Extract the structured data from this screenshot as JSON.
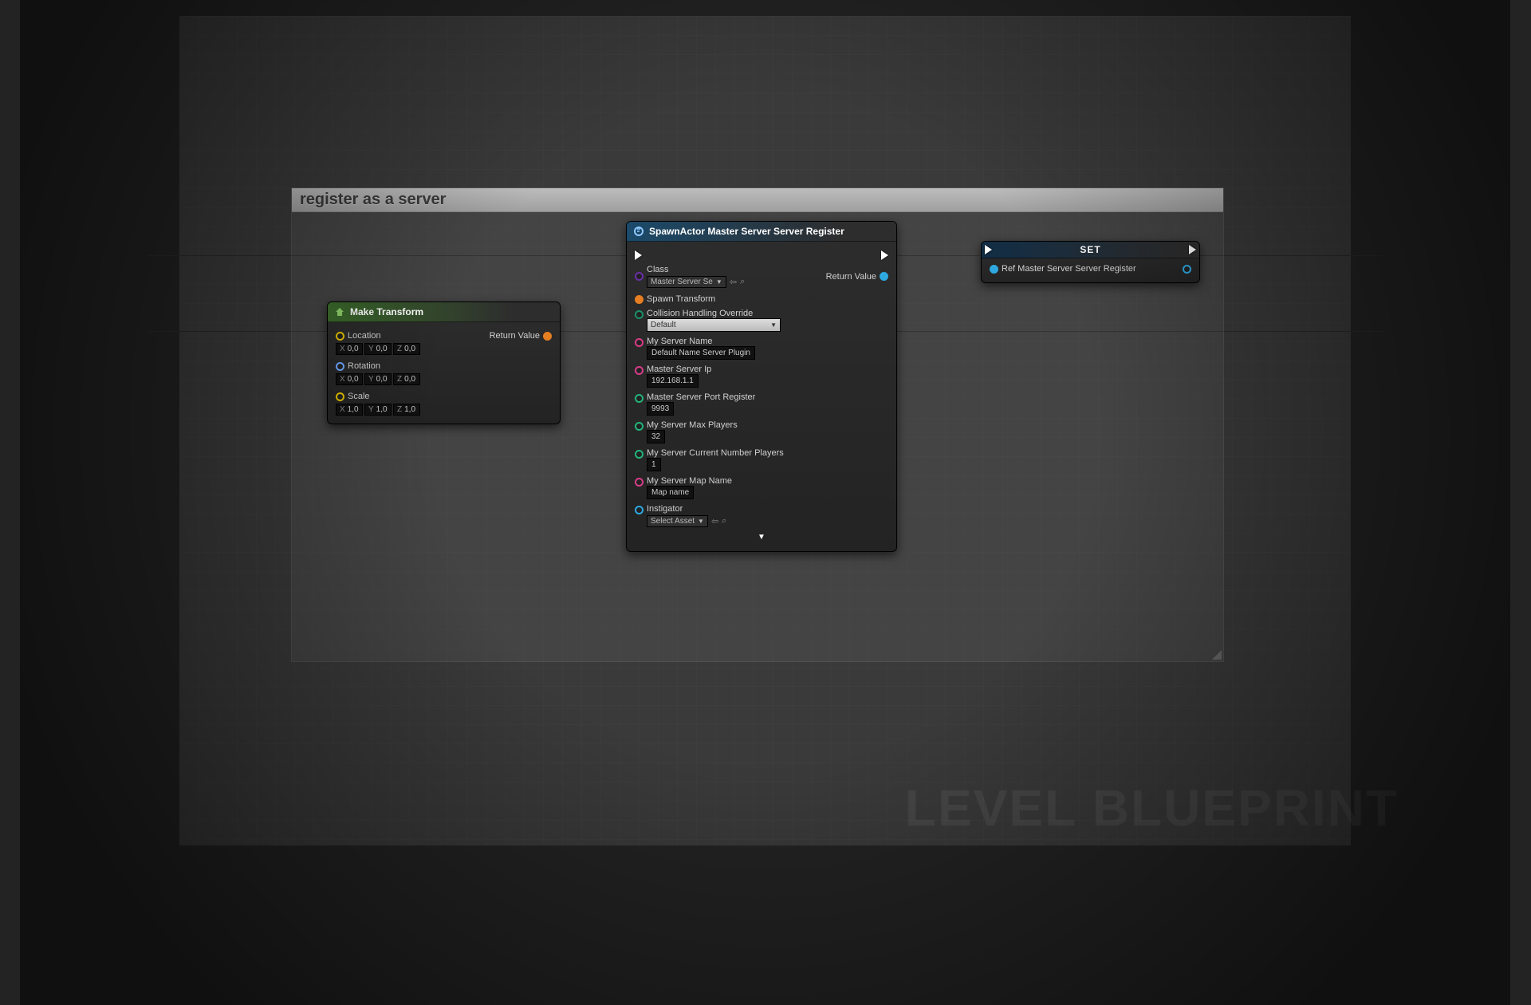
{
  "watermark": "LEVEL BLUEPRINT",
  "comment": {
    "title": "register as a server"
  },
  "makeTransform": {
    "title": "Make Transform",
    "loc_label": "Location",
    "rot_label": "Rotation",
    "scale_label": "Scale",
    "return_label": "Return Value",
    "loc": {
      "x": "0,0",
      "y": "0,0",
      "z": "0,0"
    },
    "rot": {
      "x": "0,0",
      "y": "0,0",
      "z": "0,0"
    },
    "scale": {
      "x": "1,0",
      "y": "1,0",
      "z": "1,0"
    },
    "ax_x": "X",
    "ax_y": "Y",
    "ax_z": "Z"
  },
  "spawn": {
    "title": "SpawnActor Master Server Server Register",
    "class_label": "Class",
    "class_value": "Master Server Se",
    "return_label": "Return Value",
    "spawn_transform": "Spawn Transform",
    "collision_label": "Collision Handling Override",
    "collision_value": "Default",
    "server_name_label": "My Server Name",
    "server_name_value": "Default Name Server Plugin",
    "ip_label": "Master Server Ip",
    "ip_value": "192.168.1.1",
    "port_label": "Master Server Port Register",
    "port_value": "9993",
    "max_label": "My Server Max Players",
    "max_value": "32",
    "cur_label": "My Server Current Number Players",
    "cur_value": "1",
    "map_label": "My Server Map Name",
    "map_value": "Map name",
    "instigator_label": "Instigator",
    "instigator_value": "Select Asset"
  },
  "set": {
    "title": "SET",
    "pin_label": "Ref Master Server Server Register"
  }
}
